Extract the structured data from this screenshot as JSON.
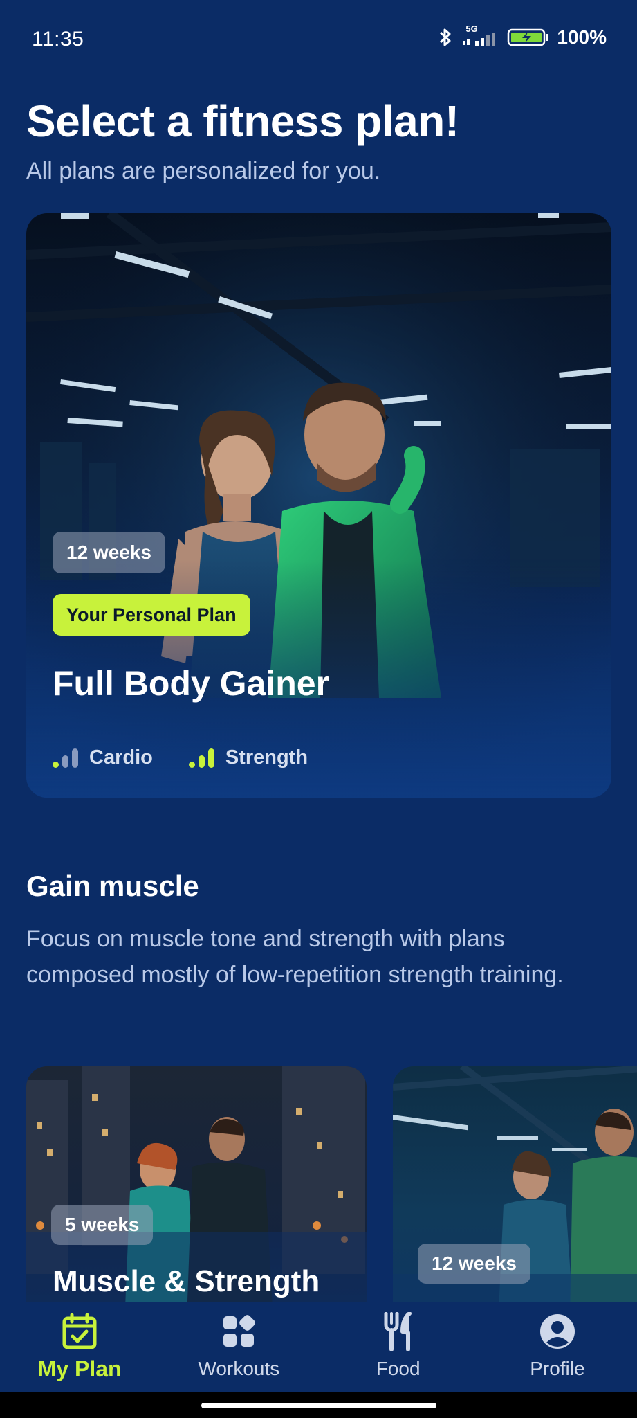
{
  "status_bar": {
    "time": "11:35",
    "network": "5G",
    "battery": "100%"
  },
  "header": {
    "title": "Select a fitness plan!",
    "subtitle": "All plans are personalized for you."
  },
  "featured_plan": {
    "duration": "12 weeks",
    "tag": "Your Personal Plan",
    "title": "Full Body Gainer",
    "stats": [
      {
        "label": "Cardio",
        "level": 1,
        "max": 3
      },
      {
        "label": "Strength",
        "level": 3,
        "max": 3
      }
    ]
  },
  "section": {
    "title": "Gain muscle",
    "description": "Focus on muscle tone and strength with plans composed mostly of low-repetition strength training."
  },
  "plan_cards": [
    {
      "duration": "5 weeks",
      "title": "Muscle & Strength"
    },
    {
      "duration": "12 weeks",
      "title": ""
    }
  ],
  "bottom_nav": {
    "items": [
      {
        "label": "My Plan",
        "icon": "calendar-check-icon",
        "active": true
      },
      {
        "label": "Workouts",
        "icon": "grid-icon",
        "active": false
      },
      {
        "label": "Food",
        "icon": "utensils-icon",
        "active": false
      },
      {
        "label": "Profile",
        "icon": "user-circle-icon",
        "active": false
      }
    ]
  },
  "colors": {
    "background": "#0b2c66",
    "accent": "#c8f23b",
    "muted_text": "#b9c9e8"
  }
}
